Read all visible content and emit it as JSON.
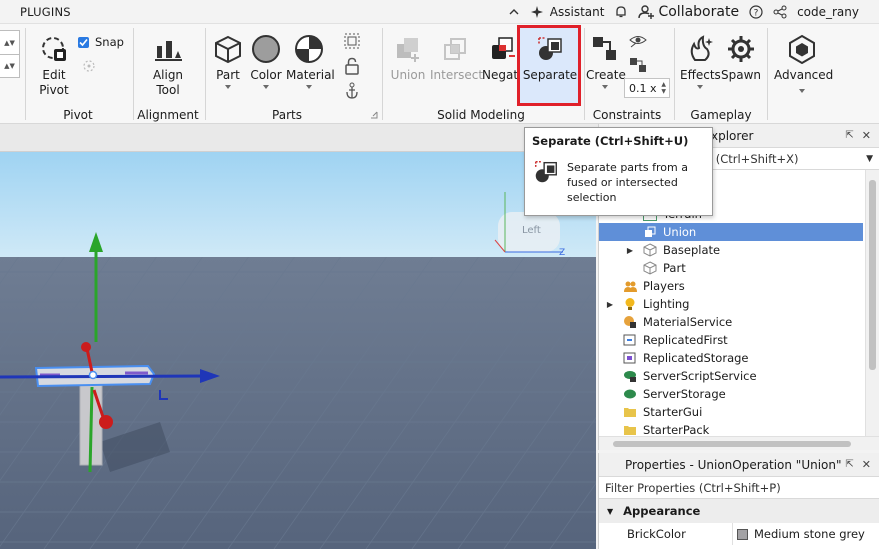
{
  "topbar": {
    "tab": "PLUGINS",
    "assistant": "Assistant",
    "collaborate": "Collaborate",
    "user": "code_rany"
  },
  "ribbon": {
    "pivot": {
      "snap": "Snap",
      "edit_pivot": "Edit\nPivot",
      "label": "Pivot"
    },
    "alignment": {
      "align_tool": "Align\nTool",
      "label": "Alignment"
    },
    "parts": {
      "part": "Part",
      "color": "Color",
      "material": "Material",
      "label": "Parts"
    },
    "solid_modeling": {
      "union": "Union",
      "intersect": "Intersect",
      "negate": "Negate",
      "separate": "Separate",
      "label": "Solid Modeling"
    },
    "constraints": {
      "create": "Create",
      "increment": "0.1 x",
      "label": "Constraints"
    },
    "gameplay": {
      "effects": "Effects",
      "spawn": "Spawn",
      "label": "Gameplay"
    },
    "advanced": {
      "advanced": "Advanced"
    }
  },
  "tooltip": {
    "title": "Separate (Ctrl+Shift+U)",
    "description": "Separate parts from a fused or intersected selection"
  },
  "viewport": {
    "view_cube_label": "Left",
    "axis_z": "Z"
  },
  "explorer": {
    "title": "xplorer",
    "filter": "e (Ctrl+Shift+X)",
    "items": [
      {
        "label": "Terrain",
        "indent": 2
      },
      {
        "label": "Union",
        "indent": 2,
        "selected": true
      },
      {
        "label": "Baseplate",
        "indent": 2,
        "expandable": true
      },
      {
        "label": "Part",
        "indent": 2
      },
      {
        "label": "Players",
        "indent": 1
      },
      {
        "label": "Lighting",
        "indent": 1,
        "expandable": true
      },
      {
        "label": "MaterialService",
        "indent": 1
      },
      {
        "label": "ReplicatedFirst",
        "indent": 1
      },
      {
        "label": "ReplicatedStorage",
        "indent": 1
      },
      {
        "label": "ServerScriptService",
        "indent": 1
      },
      {
        "label": "ServerStorage",
        "indent": 1
      },
      {
        "label": "StarterGui",
        "indent": 1
      },
      {
        "label": "StarterPack",
        "indent": 1
      }
    ]
  },
  "properties": {
    "title": "Properties - UnionOperation \"Union\"",
    "filter": "Filter Properties (Ctrl+Shift+P)",
    "section": "Appearance",
    "brickcolor_label": "BrickColor",
    "brickcolor_value": "Medium stone grey"
  }
}
